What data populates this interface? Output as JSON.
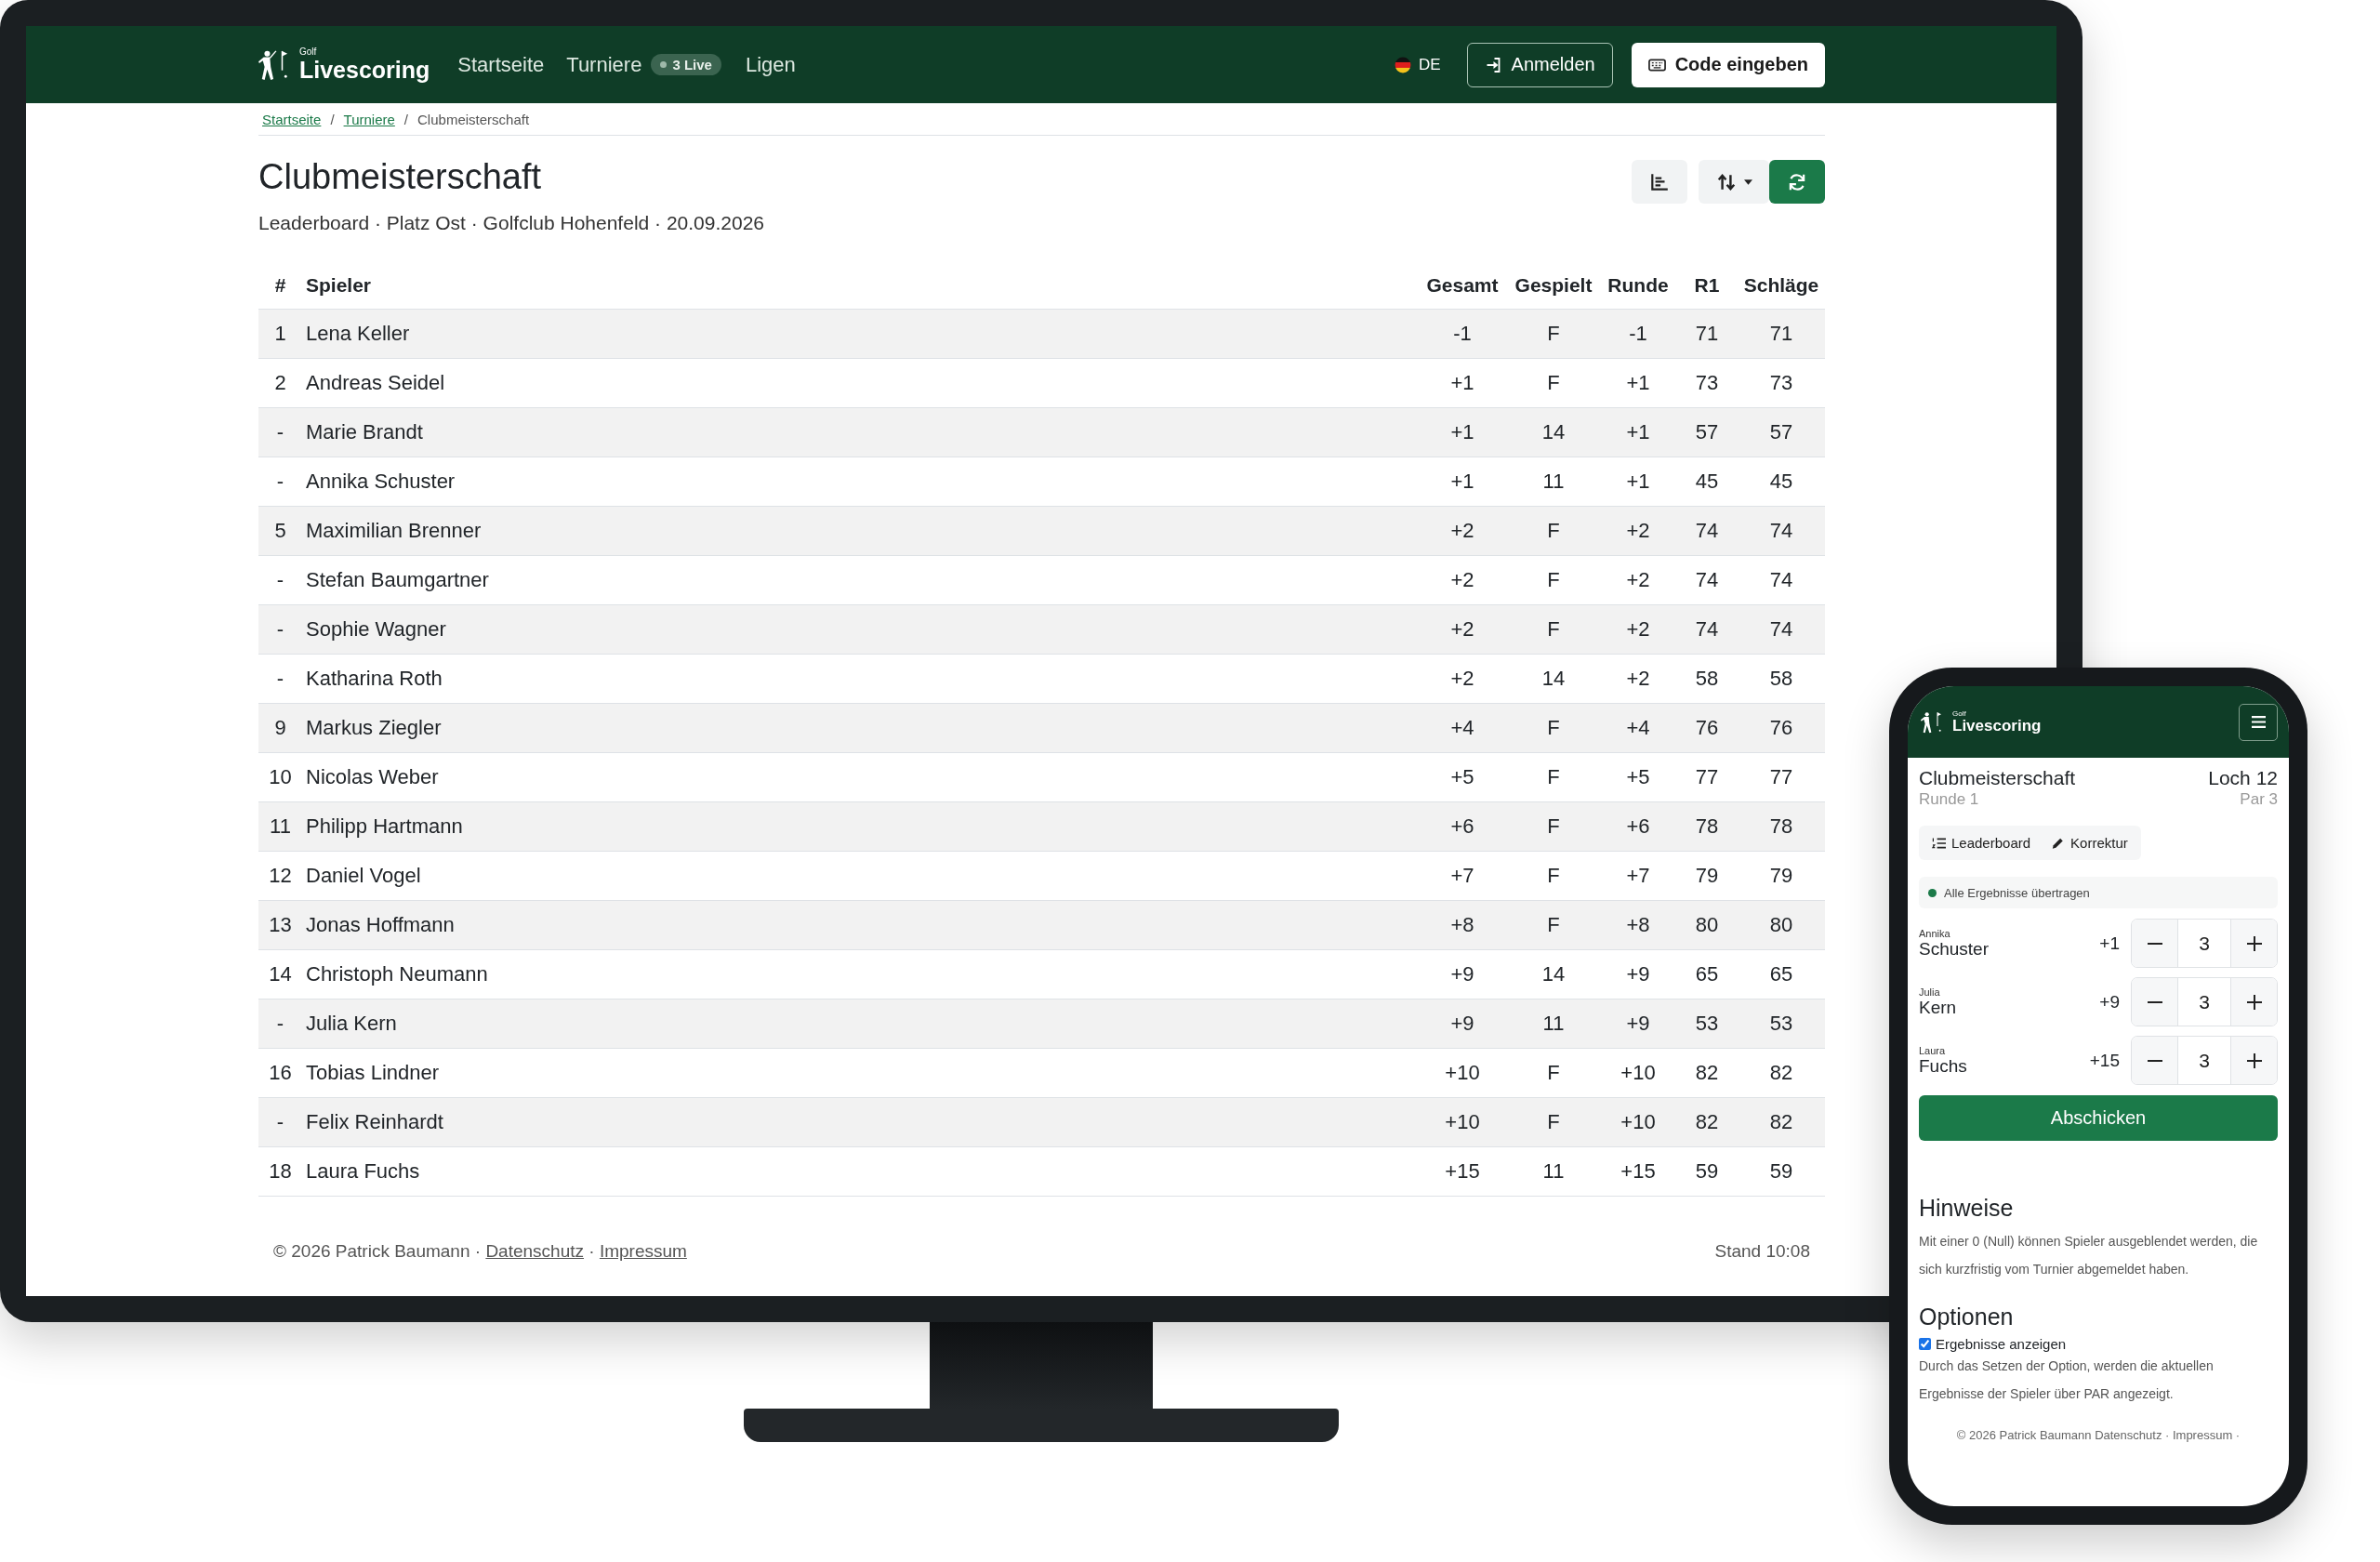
{
  "monitor": {
    "nav": {
      "logo_small": "Golf",
      "logo": "Livescoring",
      "links": [
        {
          "label": "Startseite"
        },
        {
          "label": "Turniere",
          "badge": "3 Live"
        },
        {
          "label": "Ligen"
        }
      ],
      "language": "DE",
      "login_button": "Anmelden",
      "code_button": "Code eingeben"
    },
    "breadcrumb": [
      {
        "label": "Startseite",
        "link": true
      },
      {
        "separator_before": "/",
        "label": "Turniere",
        "link": true
      },
      {
        "separator_before": "/",
        "label": "Clubmeisterschaft",
        "link": false
      }
    ],
    "title": "Clubmeisterschaft",
    "subtitle": "Leaderboard · Platz Ost · Golfclub Hohenfeld · 20.09.2026",
    "table": {
      "columns": [
        "#",
        "Spieler",
        "Gesamt",
        "Gespielt",
        "Runde",
        "R1",
        "Schläge"
      ],
      "rows": [
        [
          "1",
          "Lena Keller",
          "-1",
          "F",
          "-1",
          "71",
          "71"
        ],
        [
          "2",
          "Andreas Seidel",
          "+1",
          "F",
          "+1",
          "73",
          "73"
        ],
        [
          "-",
          "Marie Brandt",
          "+1",
          "14",
          "+1",
          "57",
          "57"
        ],
        [
          "-",
          "Annika Schuster",
          "+1",
          "11",
          "+1",
          "45",
          "45"
        ],
        [
          "5",
          "Maximilian Brenner",
          "+2",
          "F",
          "+2",
          "74",
          "74"
        ],
        [
          "-",
          "Stefan Baumgartner",
          "+2",
          "F",
          "+2",
          "74",
          "74"
        ],
        [
          "-",
          "Sophie Wagner",
          "+2",
          "F",
          "+2",
          "74",
          "74"
        ],
        [
          "-",
          "Katharina Roth",
          "+2",
          "14",
          "+2",
          "58",
          "58"
        ],
        [
          "9",
          "Markus Ziegler",
          "+4",
          "F",
          "+4",
          "76",
          "76"
        ],
        [
          "10",
          "Nicolas Weber",
          "+5",
          "F",
          "+5",
          "77",
          "77"
        ],
        [
          "11",
          "Philipp Hartmann",
          "+6",
          "F",
          "+6",
          "78",
          "78"
        ],
        [
          "12",
          "Daniel Vogel",
          "+7",
          "F",
          "+7",
          "79",
          "79"
        ],
        [
          "13",
          "Jonas Hoffmann",
          "+8",
          "F",
          "+8",
          "80",
          "80"
        ],
        [
          "14",
          "Christoph Neumann",
          "+9",
          "14",
          "+9",
          "65",
          "65"
        ],
        [
          "-",
          "Julia Kern",
          "+9",
          "11",
          "+9",
          "53",
          "53"
        ],
        [
          "16",
          "Tobias Lindner",
          "+10",
          "F",
          "+10",
          "82",
          "82"
        ],
        [
          "-",
          "Felix Reinhardt",
          "+10",
          "F",
          "+10",
          "82",
          "82"
        ],
        [
          "18",
          "Laura Fuchs",
          "+15",
          "11",
          "+15",
          "59",
          "59"
        ]
      ]
    },
    "footer": {
      "copyright": "© 2026 Patrick Baumann",
      "separator": "·",
      "links": [
        "Datenschutz",
        "Impressum"
      ],
      "updated": "Stand 10:08"
    }
  },
  "phone": {
    "nav": {
      "logo_small": "Golf",
      "logo": "Livescoring"
    },
    "title": "Clubmeisterschaft",
    "round": "Runde 1",
    "hole": "Loch 12",
    "par": "Par 3",
    "tabs": [
      {
        "label": "Leaderboard",
        "kind": "list"
      },
      {
        "label": "Korrektur",
        "kind": "pencil"
      }
    ],
    "status": "Alle Ergebnisse übertragen",
    "players": [
      {
        "first_name": "Annika",
        "last_name": "Schuster",
        "score": "+1",
        "strokes": "3"
      },
      {
        "first_name": "Julia",
        "last_name": "Kern",
        "score": "+9",
        "strokes": "3"
      },
      {
        "first_name": "Laura",
        "last_name": "Fuchs",
        "score": "+15",
        "strokes": "3"
      }
    ],
    "submit": "Abschicken",
    "notes": {
      "heading": "Hinweise",
      "text": "Mit einer 0 (Null) können Spieler ausgeblendet werden, die sich kurzfristig vom Turnier abgemeldet haben."
    },
    "options": {
      "heading": "Optionen",
      "checkbox": {
        "label": "Ergebnisse anzeigen",
        "checked": true
      },
      "text": "Durch das Setzen der Option, werden die aktuellen Ergebnisse der Spieler über PAR angezeigt."
    },
    "footer": "© 2026 Patrick Baumann Datenschutz · Impressum ·"
  }
}
